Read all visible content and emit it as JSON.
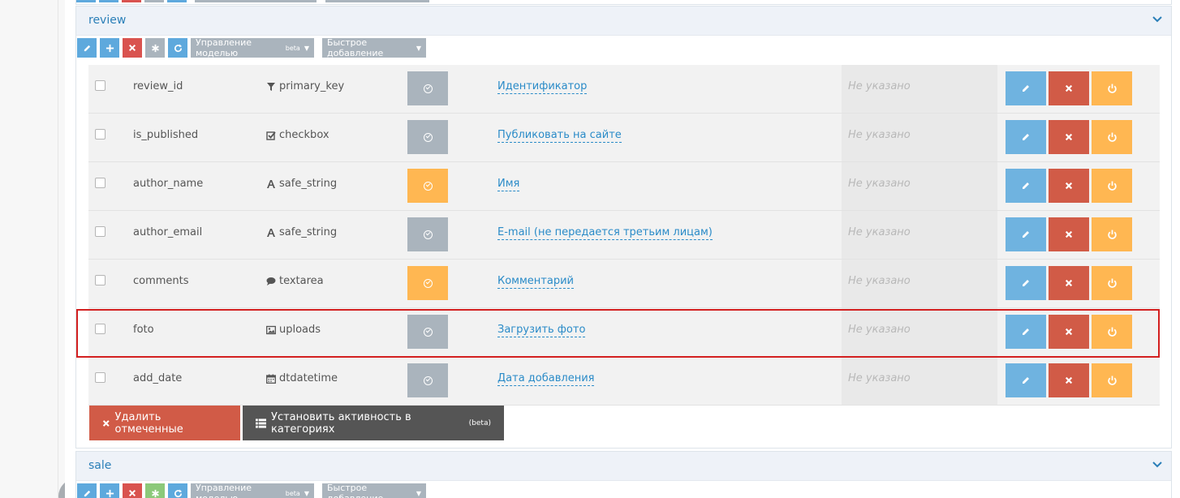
{
  "review_panel": {
    "title": "review",
    "toolbar": {
      "model_menu_label": "Управление моделью",
      "model_menu_badge": "beta",
      "quick_add_label": "Быстрое добавление"
    },
    "fields": [
      {
        "name": "review_id",
        "type": "primary_key",
        "type_icon": "filter-icon",
        "active": false,
        "label": "Идентификатор",
        "default": "Не указано"
      },
      {
        "name": "is_published",
        "type": "checkbox",
        "type_icon": "checkbox-icon",
        "active": false,
        "label": "Публиковать на сайте",
        "default": "Не указано"
      },
      {
        "name": "author_name",
        "type": "safe_string",
        "type_icon": "font-icon",
        "active": true,
        "label": "Имя",
        "default": "Не указано"
      },
      {
        "name": "author_email",
        "type": "safe_string",
        "type_icon": "font-icon",
        "active": false,
        "label": "E-mail (не передается третьим лицам)",
        "default": "Не указано"
      },
      {
        "name": "comments",
        "type": "textarea",
        "type_icon": "comment-icon",
        "active": true,
        "label": "Комментарий",
        "default": "Не указано"
      },
      {
        "name": "foto",
        "type": "uploads",
        "type_icon": "picture-icon",
        "active": false,
        "label": "Загрузить фото",
        "default": "Не указано",
        "highlighted": true
      },
      {
        "name": "add_date",
        "type": "dtdatetime",
        "type_icon": "calendar-icon",
        "active": false,
        "label": "Дата добавления",
        "default": "Не указано"
      }
    ],
    "bulk_actions": {
      "delete_selected": "Удалить отмеченные",
      "set_category_activity": "Установить активность в категориях",
      "set_category_activity_badge": "(beta)"
    }
  },
  "sale_panel": {
    "title": "sale",
    "toolbar": {
      "model_menu_label": "Управление моделью",
      "model_menu_badge": "beta",
      "quick_add_label": "Быстрое добавление"
    }
  },
  "colors": {
    "accent_blue": "#2a8bc8",
    "edit_blue": "#6fb3e0",
    "delete_red": "#d15b47",
    "power_orange": "#ffb752",
    "toggle_gray": "#aab4bd",
    "highlight_red": "#d32020"
  }
}
